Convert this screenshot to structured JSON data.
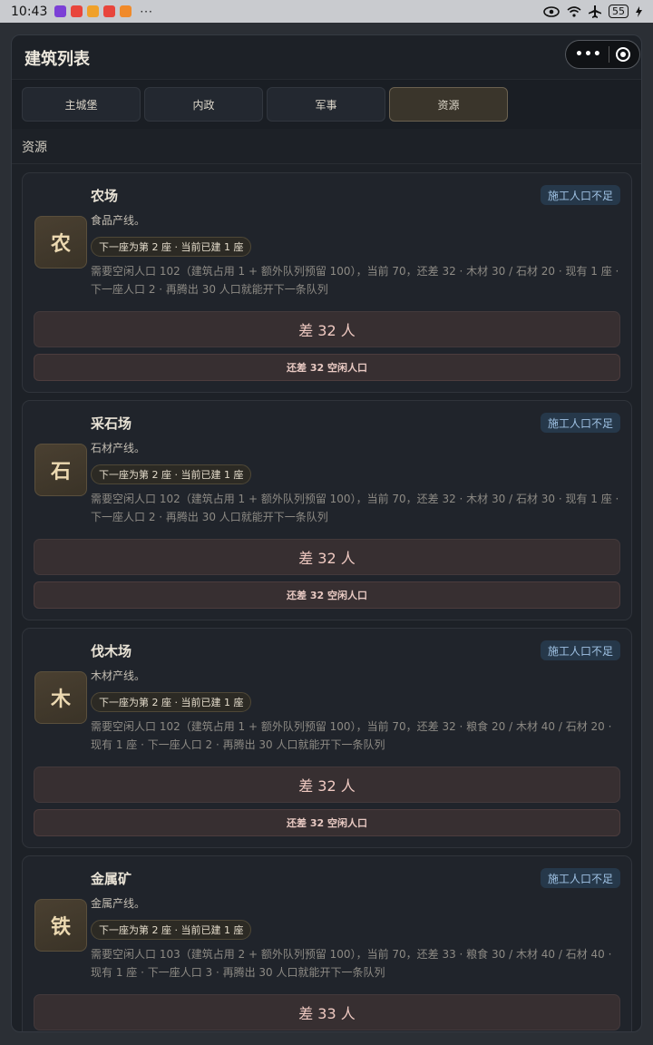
{
  "status_bar": {
    "time": "10:43",
    "battery": "55",
    "dots": "···"
  },
  "header": {
    "title": "建筑列表",
    "close_label": "关闭",
    "more_glyph": "•••"
  },
  "tabs": [
    {
      "label": "主城堡",
      "active": false
    },
    {
      "label": "内政",
      "active": false
    },
    {
      "label": "军事",
      "active": false
    },
    {
      "label": "资源",
      "active": true
    }
  ],
  "section": {
    "title": "资源"
  },
  "cards": [
    {
      "icon_char": "农",
      "name": "农场",
      "badge": "施工人口不足",
      "desc": "食品产线。",
      "pill": "下一座为第 2 座 · 当前已建 1 座",
      "detail": "需要空闲人口 102（建筑占用 1 + 额外队列预留 100），当前 70，还差 32 · 木材 30 / 石材 20 · 现有 1 座 · 下一座人口 2 · 再腾出 30 人口就能开下一条队列",
      "main_button": "差 32 人",
      "sub_button": "还差 32 空闲人口"
    },
    {
      "icon_char": "石",
      "name": "采石场",
      "badge": "施工人口不足",
      "desc": "石材产线。",
      "pill": "下一座为第 2 座 · 当前已建 1 座",
      "detail": "需要空闲人口 102（建筑占用 1 + 额外队列预留 100），当前 70，还差 32 · 木材 30 / 石材 30 · 现有 1 座 · 下一座人口 2 · 再腾出 30 人口就能开下一条队列",
      "main_button": "差 32 人",
      "sub_button": "还差 32 空闲人口"
    },
    {
      "icon_char": "木",
      "name": "伐木场",
      "badge": "施工人口不足",
      "desc": "木材产线。",
      "pill": "下一座为第 2 座 · 当前已建 1 座",
      "detail": "需要空闲人口 102（建筑占用 1 + 额外队列预留 100），当前 70，还差 32 · 粮食 20 / 木材 40 / 石材 20 · 现有 1 座 · 下一座人口 2 · 再腾出 30 人口就能开下一条队列",
      "main_button": "差 32 人",
      "sub_button": "还差 32 空闲人口"
    },
    {
      "icon_char": "铁",
      "name": "金属矿",
      "badge": "施工人口不足",
      "desc": "金属产线。",
      "pill": "下一座为第 2 座 · 当前已建 1 座",
      "detail": "需要空闲人口 103（建筑占用 2 + 额外队列预留 100），当前 70，还差 33 · 粮食 30 / 木材 40 / 石材 40 · 现有 1 座 · 下一座人口 3 · 再腾出 30 人口就能开下一条队列",
      "main_button": "差 33 人",
      "sub_button": ""
    }
  ],
  "colors": {
    "panel_bg": "#1d2127",
    "active_tab": "#3a352b",
    "badge_bg": "#26384a",
    "button_bg": "#372f31"
  }
}
